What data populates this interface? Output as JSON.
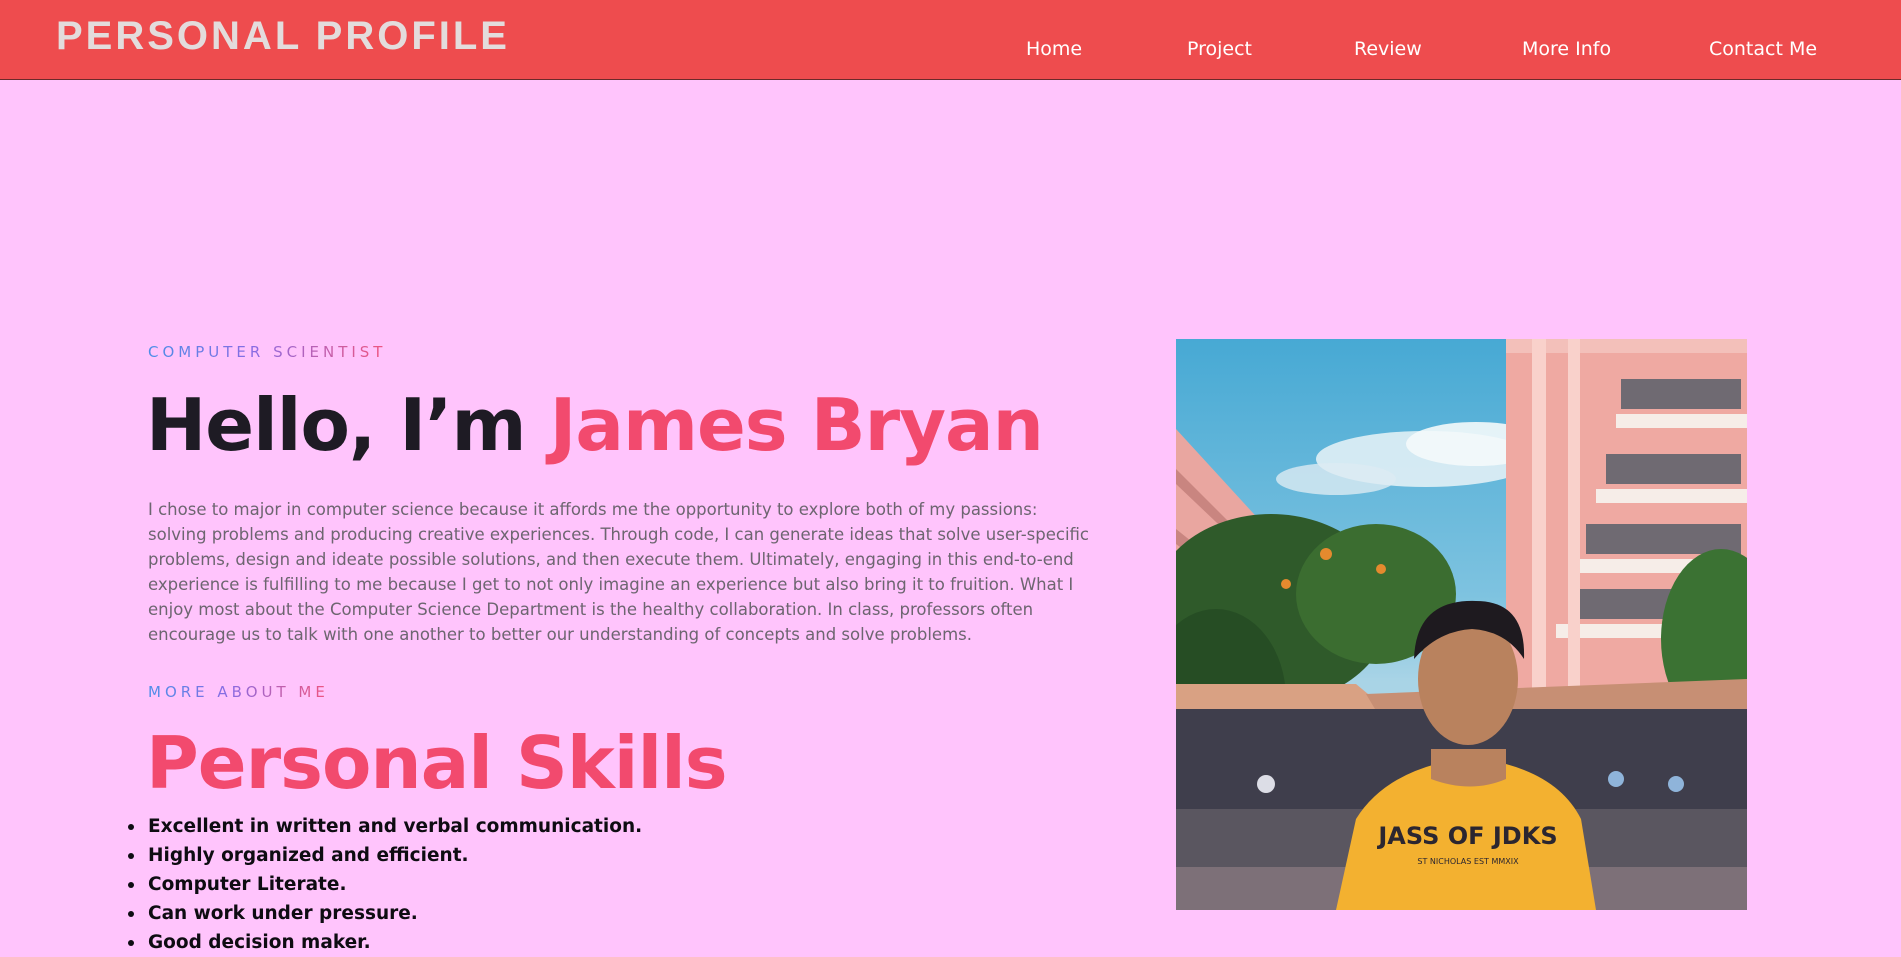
{
  "header": {
    "brand": "PERSONAL PROFILE",
    "nav": [
      "Home",
      "Project",
      "Review",
      "More Info",
      "Contact Me"
    ]
  },
  "hero": {
    "eyebrow": "COMPUTER SCIENTIST",
    "greeting": "Hello, I’m",
    "name": "James Bryan",
    "bio": "I chose to major in computer science because it affords me the opportunity to explore both of my passions: solving problems and producing creative experiences. Through code, I can generate ideas that solve user-specific problems, design and ideate possible solutions, and then execute them. Ultimately, engaging in this end-to-end experience is fulfilling to me because I get to not only imagine an experience but also bring it to fruition. What I enjoy most about the Computer Science Department is the healthy collaboration. In class, professors often encourage us to talk with one another to better our understanding of concepts and solve problems."
  },
  "skills": {
    "eyebrow": "MORE ABOUT ME",
    "title": "Personal Skills",
    "items": [
      "Excellent in written and verbal communication.",
      "Highly organized and efficient.",
      "Computer Literate.",
      "Can work under pressure.",
      "Good decision maker."
    ]
  },
  "photo": {
    "shirt_text": "JASS OF JDKS",
    "shirt_subtext": "ST NICHOLAS EST MMXIX"
  },
  "colors": {
    "background": "#ffc4fc",
    "navbar": "#ee4c4e",
    "accent": "#f24a6e",
    "heading": "#1e1b24",
    "body_text": "#6d6570"
  }
}
